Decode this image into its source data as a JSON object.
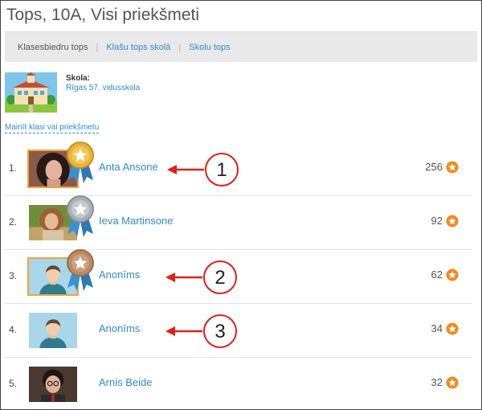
{
  "page": {
    "title": "Tops, 10A, Visi priekšmeti"
  },
  "tabs": [
    {
      "label": "Klasesbiedru tops",
      "active": true
    },
    {
      "label": "Klašu tops skolā",
      "active": false
    },
    {
      "label": "Skolu tops",
      "active": false
    }
  ],
  "tab_separator": "|",
  "school": {
    "label": "Skola:",
    "name": "Rīgas 57. vidusskola",
    "image": "school-building-illustration"
  },
  "change_link": "Mainīt klasi vai priekšmetu",
  "ranking": [
    {
      "rank": "1.",
      "name": "Anta Ansone",
      "score": "256",
      "medal": "gold",
      "avatar": "photo-girl-dark-hair"
    },
    {
      "rank": "2.",
      "name": "Ieva Martinsone",
      "score": "92",
      "medal": "silver",
      "avatar": "photo-girl-outdoors"
    },
    {
      "rank": "3.",
      "name": "Anonīms",
      "score": "62",
      "medal": "bronze",
      "avatar": "anonymous-user"
    },
    {
      "rank": "4.",
      "name": "Anonīms",
      "score": "34",
      "medal": "none",
      "avatar": "anonymous-user"
    },
    {
      "rank": "5.",
      "name": "Arnis Beide",
      "score": "32",
      "medal": "none",
      "avatar": "photo-boy-glasses"
    }
  ],
  "callouts": [
    {
      "number": "1",
      "row": 1
    },
    {
      "number": "2",
      "row": 3
    },
    {
      "number": "3",
      "row": 4
    }
  ],
  "colors": {
    "link": "#2e8ccf",
    "tabbar_bg": "#e9e9e9",
    "avatar_frame": "#f0a43a",
    "annotation_red": "#e0201b",
    "score_star": "#f08a1c",
    "medal_gold": "#e9b43a",
    "medal_silver": "#a9b0b6",
    "medal_bronze": "#b98a64",
    "ribbon": "#3c8fd0"
  }
}
